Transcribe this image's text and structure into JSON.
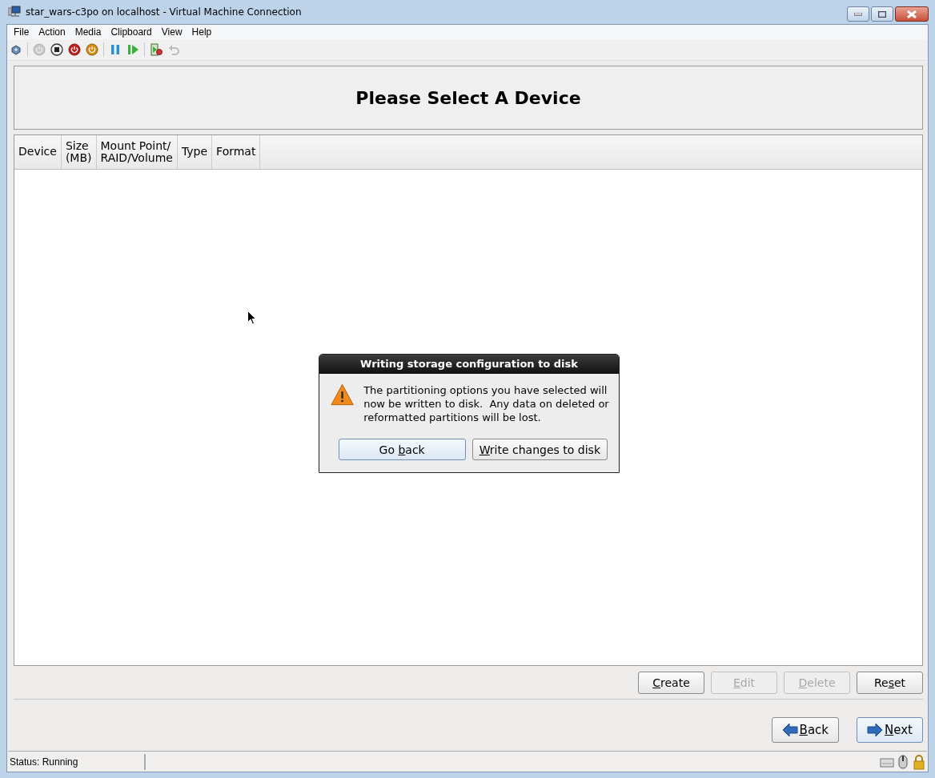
{
  "window": {
    "title": "star_wars-c3po on localhost - Virtual Machine Connection"
  },
  "menu": [
    "File",
    "Action",
    "Media",
    "Clipboard",
    "View",
    "Help"
  ],
  "toolbar": [
    {
      "kind": "connect",
      "disabled": false
    },
    {
      "kind": "sep"
    },
    {
      "kind": "start",
      "disabled": true
    },
    {
      "kind": "stop",
      "disabled": false
    },
    {
      "kind": "shutdown",
      "disabled": false
    },
    {
      "kind": "power",
      "disabled": false
    },
    {
      "kind": "sep"
    },
    {
      "kind": "pause",
      "disabled": false
    },
    {
      "kind": "resume",
      "disabled": false
    },
    {
      "kind": "sep"
    },
    {
      "kind": "snapshot",
      "disabled": false
    },
    {
      "kind": "revert",
      "disabled": true
    }
  ],
  "screen": {
    "title": "Please Select A Device",
    "columns": [
      "Device",
      "Size\n(MB)",
      "Mount Point/\nRAID/Volume",
      "Type",
      "Format"
    ],
    "actions": [
      {
        "key": "C",
        "post": "reate",
        "disabled": false
      },
      {
        "key": "E",
        "post": "dit",
        "disabled": true
      },
      {
        "key": "D",
        "post": "elete",
        "disabled": true
      },
      {
        "pre": "Re",
        "key": "s",
        "post": "et",
        "disabled": false
      }
    ],
    "nav": [
      {
        "kind": "back",
        "key": "B",
        "post": "ack",
        "default": false
      },
      {
        "kind": "next",
        "key": "N",
        "post": "ext",
        "default": true
      }
    ]
  },
  "dialog": {
    "title": "Writing storage configuration to disk",
    "message": "The partitioning options you have selected will now be written to disk.  Any data on deleted or reformatted partitions will be lost.",
    "buttons": [
      {
        "pre": "Go ",
        "key": "b",
        "post": "ack",
        "default": true
      },
      {
        "key": "W",
        "post": "rite changes to disk",
        "default": false
      }
    ]
  },
  "status": {
    "text": "Status: Running"
  }
}
